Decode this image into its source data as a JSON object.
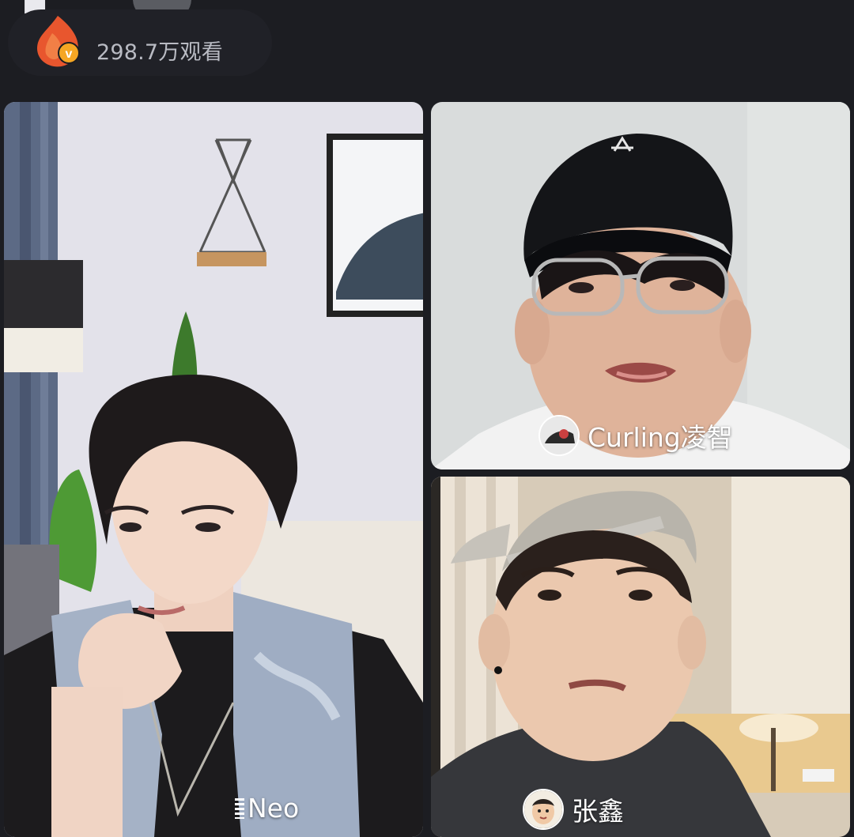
{
  "stream": {
    "viewer_count": "298.7万观看",
    "brand_icon": "weibo-verified-flame-icon",
    "accent_color": "#e8562e"
  },
  "participants": [
    {
      "name": "Neo",
      "icon": "mic-level-icon"
    },
    {
      "name": "Curling凌智",
      "icon": "avatar"
    },
    {
      "name": "张鑫",
      "icon": "avatar"
    }
  ]
}
